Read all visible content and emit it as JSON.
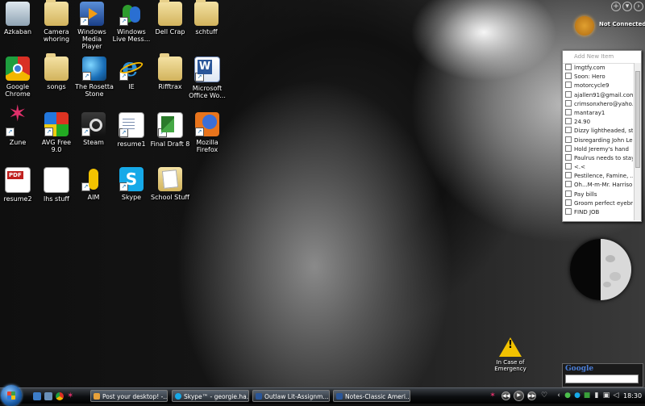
{
  "desktop_icons": [
    {
      "id": "recycle-bin",
      "label": "Azkaban",
      "icon": "recycle-bin-icon"
    },
    {
      "id": "camera",
      "label": "Camera whoring",
      "icon": "folder-icon"
    },
    {
      "id": "wmp",
      "label": "Windows Media Player",
      "icon": "media-player-icon"
    },
    {
      "id": "msn",
      "label": "Windows Live Mess...",
      "icon": "messenger-icon"
    },
    {
      "id": "dellcrap",
      "label": "Dell Crap",
      "icon": "folder-icon"
    },
    {
      "id": "schtuff",
      "label": "schtuff",
      "icon": "folder-icon"
    },
    {
      "id": "chrome",
      "label": "Google Chrome",
      "icon": "chrome-icon"
    },
    {
      "id": "songs",
      "label": "songs",
      "icon": "folder-icon"
    },
    {
      "id": "rosetta",
      "label": "The Rosetta Stone",
      "icon": "globe-icon"
    },
    {
      "id": "ie",
      "label": "IE",
      "icon": "ie-icon"
    },
    {
      "id": "rifftrax",
      "label": "Rifftrax",
      "icon": "folder-icon"
    },
    {
      "id": "msoffice",
      "label": "Microsoft Office Wo...",
      "icon": "word-icon"
    },
    {
      "id": "zune",
      "label": "Zune",
      "icon": "zune-icon"
    },
    {
      "id": "avg",
      "label": "AVG Free 9.0",
      "icon": "avg-icon"
    },
    {
      "id": "steam",
      "label": "Steam",
      "icon": "steam-icon"
    },
    {
      "id": "resume1",
      "label": "resume1",
      "icon": "document-icon"
    },
    {
      "id": "finaldraft",
      "label": "Final Draft 8",
      "icon": "final-draft-icon"
    },
    {
      "id": "firefox",
      "label": "Mozilla Firefox",
      "icon": "firefox-icon"
    },
    {
      "id": "resume2",
      "label": "resume2",
      "icon": "pdf-icon"
    },
    {
      "id": "lhs",
      "label": "lhs stuff",
      "icon": "text-file-icon"
    },
    {
      "id": "aim",
      "label": "AIM",
      "icon": "aim-icon"
    },
    {
      "id": "skype",
      "label": "Skype",
      "icon": "skype-icon"
    },
    {
      "id": "schoolstuff",
      "label": "School Stuff",
      "icon": "folder-icon"
    }
  ],
  "gadgets": {
    "network": {
      "status": "Not Connected"
    },
    "notes": {
      "add_label": "Add New Item",
      "items": [
        "lmgtfy.com",
        "Soon: Hero",
        "motorcycle9",
        "ajallen91@gmail.com",
        "crimsonxhero@yaho...",
        "mantaray1",
        "24.90",
        "Dizzy lightheaded, st...",
        "Disregarding John Le...",
        "Hold Jeremy's hand",
        "Paulrus needs to stay...",
        "<.<",
        "Pestilence, Famine, ...",
        "Oh...M-m-Mr. Harriso...",
        "Pay bills",
        "Groom perfect eyebr...",
        "FIND JOB"
      ]
    },
    "emergency": {
      "label": "In Case of Emergency"
    },
    "google": {
      "logo": "Google"
    },
    "moon": {
      "phase": "first-quarter"
    }
  },
  "taskbar": {
    "tasks": [
      {
        "label": "Post your desktop! -...",
        "color": "#e8a13a"
      },
      {
        "label": "Skype™ - georgie.ha...",
        "color": "#16a9e8"
      },
      {
        "label": "Outlaw Lit-Assignm...",
        "color": "#2a5699"
      },
      {
        "label": "Notes-Classic Ameri...",
        "color": "#2a5699"
      }
    ],
    "clock": "18:30"
  }
}
